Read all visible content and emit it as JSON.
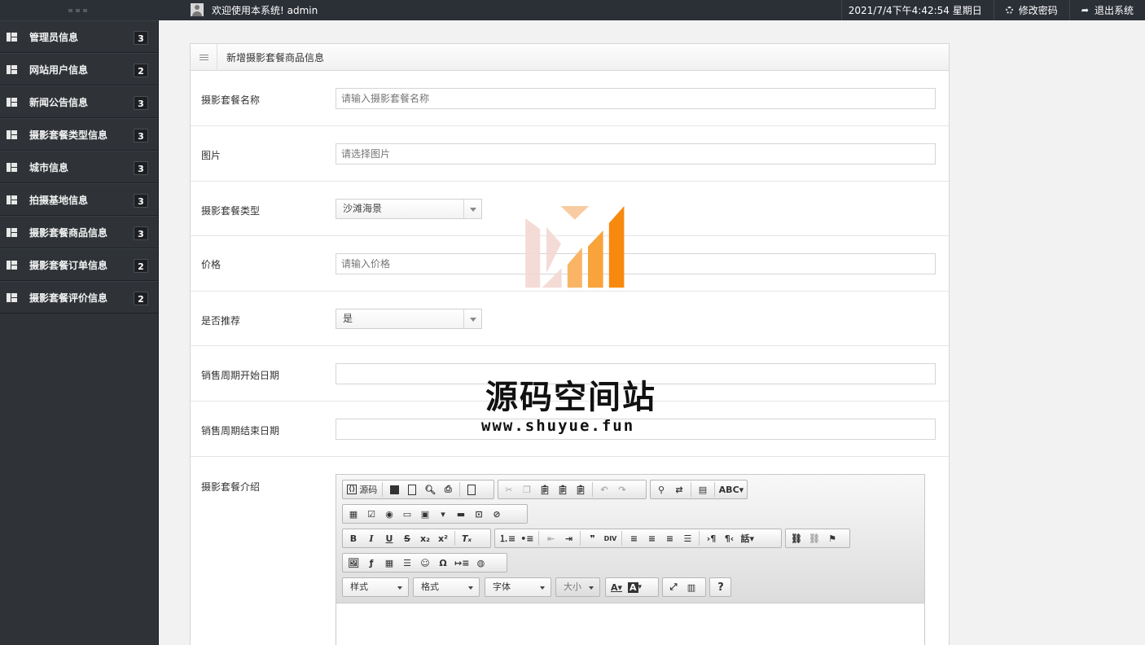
{
  "header": {
    "welcome": "欢迎使用本系统! admin",
    "datetime": "2021/7/4下午4:42:54 星期日",
    "change_password": "修改密码",
    "logout": "退出系统"
  },
  "sidebar": {
    "items": [
      {
        "label": "管理员信息",
        "count": "3"
      },
      {
        "label": "网站用户信息",
        "count": "2"
      },
      {
        "label": "新闻公告信息",
        "count": "3"
      },
      {
        "label": "摄影套餐类型信息",
        "count": "3"
      },
      {
        "label": "城市信息",
        "count": "3"
      },
      {
        "label": "拍摄基地信息",
        "count": "3"
      },
      {
        "label": "摄影套餐商品信息",
        "count": "3"
      },
      {
        "label": "摄影套餐订单信息",
        "count": "2"
      },
      {
        "label": "摄影套餐评价信息",
        "count": "2"
      }
    ]
  },
  "panel": {
    "title": "新增摄影套餐商品信息",
    "fields": {
      "name": {
        "label": "摄影套餐名称",
        "placeholder": "请输入摄影套餐名称"
      },
      "image": {
        "label": "图片",
        "placeholder": "请选择图片"
      },
      "type": {
        "label": "摄影套餐类型",
        "value": "沙滩海景"
      },
      "price": {
        "label": "价格",
        "placeholder": "请输入价格"
      },
      "recommend": {
        "label": "是否推荐",
        "value": "是"
      },
      "start_date": {
        "label": "销售周期开始日期",
        "value": ""
      },
      "end_date": {
        "label": "销售周期结束日期",
        "value": ""
      },
      "intro": {
        "label": "摄影套餐介绍"
      }
    }
  },
  "editor": {
    "source_label": "源码",
    "combos": {
      "style": "样式",
      "format": "格式",
      "font": "字体",
      "size": "大小"
    },
    "help": "?"
  },
  "watermark": {
    "title": "源码空间站",
    "url": "www.shuyue.fun",
    "colors": {
      "pink": "#f4d7d2",
      "orange": "#f7890f",
      "light_orange": "#f9b565"
    }
  }
}
